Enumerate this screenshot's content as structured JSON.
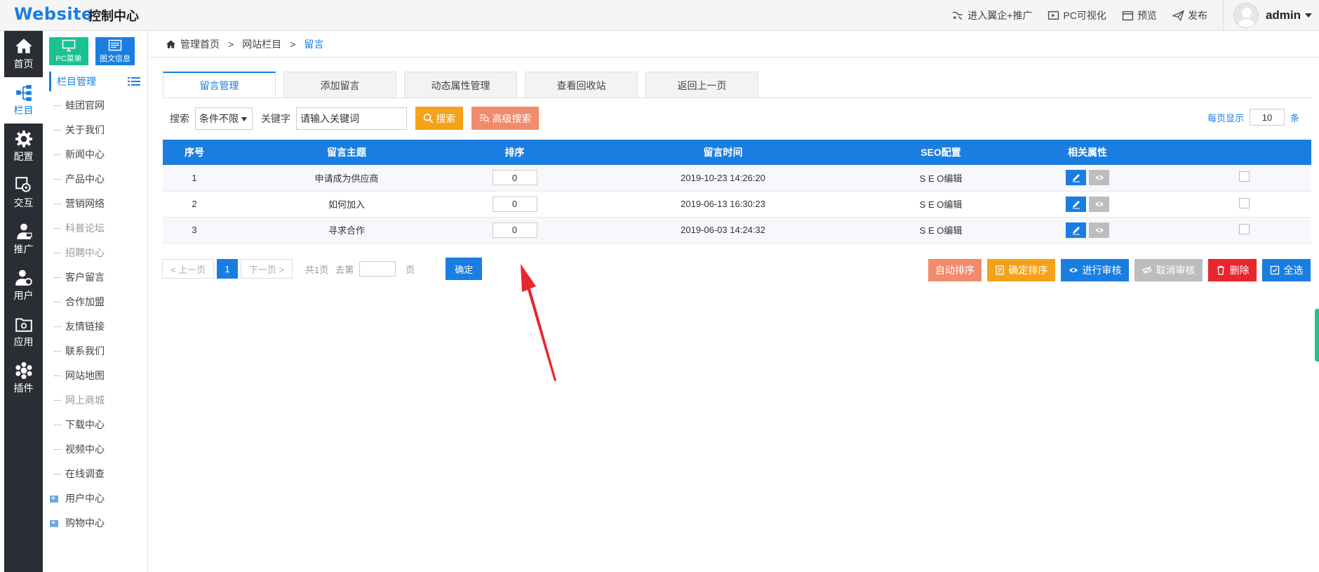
{
  "header": {
    "logo": "Website",
    "title": "控制中心",
    "links": [
      {
        "icon": "promotion-icon",
        "label": "进入翼企+推广"
      },
      {
        "icon": "pc-visual-icon",
        "label": "PC可视化"
      },
      {
        "icon": "preview-icon",
        "label": "预览"
      },
      {
        "icon": "publish-icon",
        "label": "发布"
      }
    ],
    "user": "admin"
  },
  "leftnav": [
    {
      "icon": "home-icon",
      "label": "首页"
    },
    {
      "icon": "column-icon",
      "label": "栏目"
    },
    {
      "icon": "config-icon",
      "label": "配置"
    },
    {
      "icon": "interaction-icon",
      "label": "交互"
    },
    {
      "icon": "promote-icon",
      "label": "推广"
    },
    {
      "icon": "user-icon",
      "label": "用户"
    },
    {
      "icon": "app-icon",
      "label": "应用"
    },
    {
      "icon": "plugin-icon",
      "label": "插件"
    }
  ],
  "sidebar": {
    "btn_pc": "PC菜单",
    "btn_article": "图文信息",
    "head": "栏目管理",
    "items": [
      {
        "label": "蛙团官网",
        "muted": false
      },
      {
        "label": "关于我们",
        "muted": false
      },
      {
        "label": "新闻中心",
        "muted": false
      },
      {
        "label": "产品中心",
        "muted": false
      },
      {
        "label": "营销网络",
        "muted": false
      },
      {
        "label": "科普论坛",
        "muted": true
      },
      {
        "label": "招聘中心",
        "muted": true
      },
      {
        "label": "客户留言",
        "muted": false
      },
      {
        "label": "合作加盟",
        "muted": false
      },
      {
        "label": "友情链接",
        "muted": false
      },
      {
        "label": "联系我们",
        "muted": false
      },
      {
        "label": "网站地图",
        "muted": false
      },
      {
        "label": "网上商城",
        "muted": true
      },
      {
        "label": "下载中心",
        "muted": false
      },
      {
        "label": "视频中心",
        "muted": false
      },
      {
        "label": "在线调查",
        "muted": false
      }
    ],
    "expandable": [
      "用户中心",
      "购物中心"
    ]
  },
  "breadcrumb": {
    "home": "管理首页",
    "sep": ">",
    "section": "网站栏目",
    "current": "留言"
  },
  "tabs": [
    "留言管理",
    "添加留言",
    "动态属性管理",
    "查看回收站",
    "返回上一页"
  ],
  "search": {
    "label": "搜索",
    "condition": "条件不限",
    "keyword_label": "关键字",
    "keyword_value": "请输入关键词",
    "search_btn": "搜索",
    "advanced_btn": "高级搜索",
    "perpage_label": "每页显示",
    "perpage_value": "10",
    "perpage_unit": "条"
  },
  "table": {
    "columns": [
      "序号",
      "留言主题",
      "排序",
      "留言时间",
      "SEO配置",
      "相关属性"
    ],
    "rows": [
      {
        "no": "1",
        "subject": "申请成为供应商",
        "sort": "0",
        "time": "2019-10-23 14:26:20",
        "seo": "S E O编辑"
      },
      {
        "no": "2",
        "subject": "如何加入",
        "sort": "0",
        "time": "2019-06-13 16:30:23",
        "seo": "S E O编辑"
      },
      {
        "no": "3",
        "subject": "寻求合作",
        "sort": "0",
        "time": "2019-06-03 14:24:32",
        "seo": "S E O编辑"
      }
    ]
  },
  "pager": {
    "prev": "< 上一页",
    "page": "1",
    "next": "下一页 >",
    "total": "共1页",
    "goto_prefix": "去第",
    "goto_suffix": "页",
    "confirm": "确定"
  },
  "bulk": {
    "auto_sort": "自动排序",
    "confirm_sort": "确定排序",
    "audit": "进行审核",
    "cancel_audit": "取消审核",
    "delete": "删除",
    "select_all": "全选"
  },
  "colors": {
    "primary": "#1a7ee0",
    "orange": "#f4a21a",
    "salmon": "#f28b6c",
    "red": "#e8262d",
    "green": "#1ac292",
    "dark_nav": "#2a2d33",
    "annotation": "#e8262d"
  }
}
